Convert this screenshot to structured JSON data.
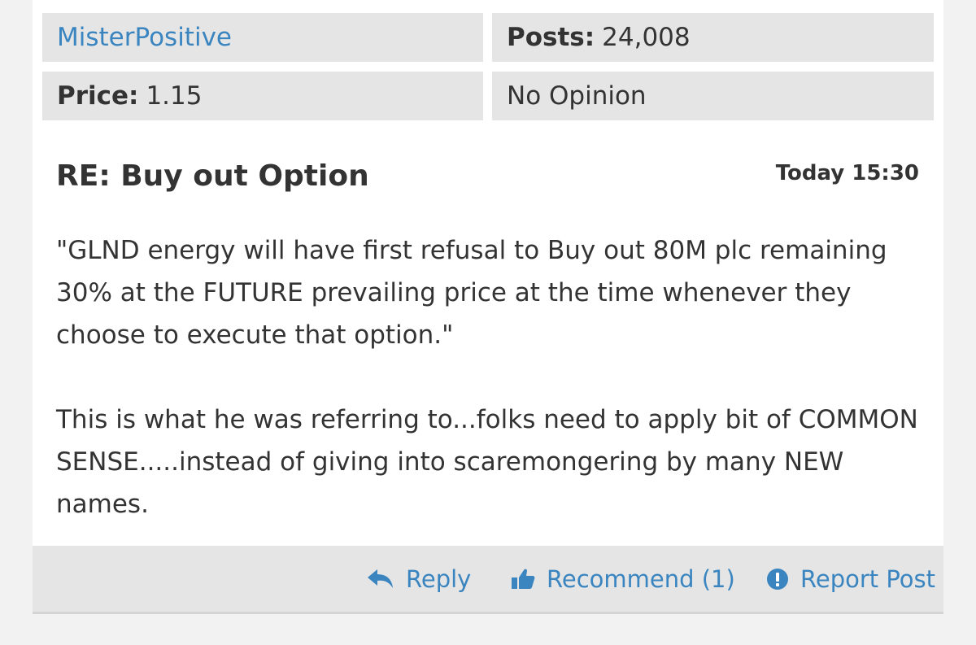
{
  "meta": {
    "username": "MisterPositive",
    "posts_label": "Posts:",
    "posts_value": "24,008",
    "price_label": "Price:",
    "price_value": "1.15",
    "opinion": "No Opinion"
  },
  "post": {
    "title": "RE: Buy out Option",
    "time": "Today 15:30",
    "paragraphs": [
      "\"GLND energy will have first refusal to Buy out 80M plc remaining 30% at the FUTURE prevailing price at the time whenever they choose to execute that option.\"",
      "This is what he was referring to...folks need to apply bit of COMMON SENSE.....instead of giving into scaremongering by many NEW names."
    ]
  },
  "actions": {
    "reply_label": "Reply",
    "recommend_label": "Recommend (1)",
    "report_label": "Report Post",
    "reply_icon": "reply-arrow-icon",
    "recommend_icon": "thumbs-up-icon",
    "report_icon": "exclamation-circle-icon"
  },
  "colors": {
    "link": "#3a85c0",
    "cell_background": "#e5e5e5",
    "text": "#333333"
  }
}
